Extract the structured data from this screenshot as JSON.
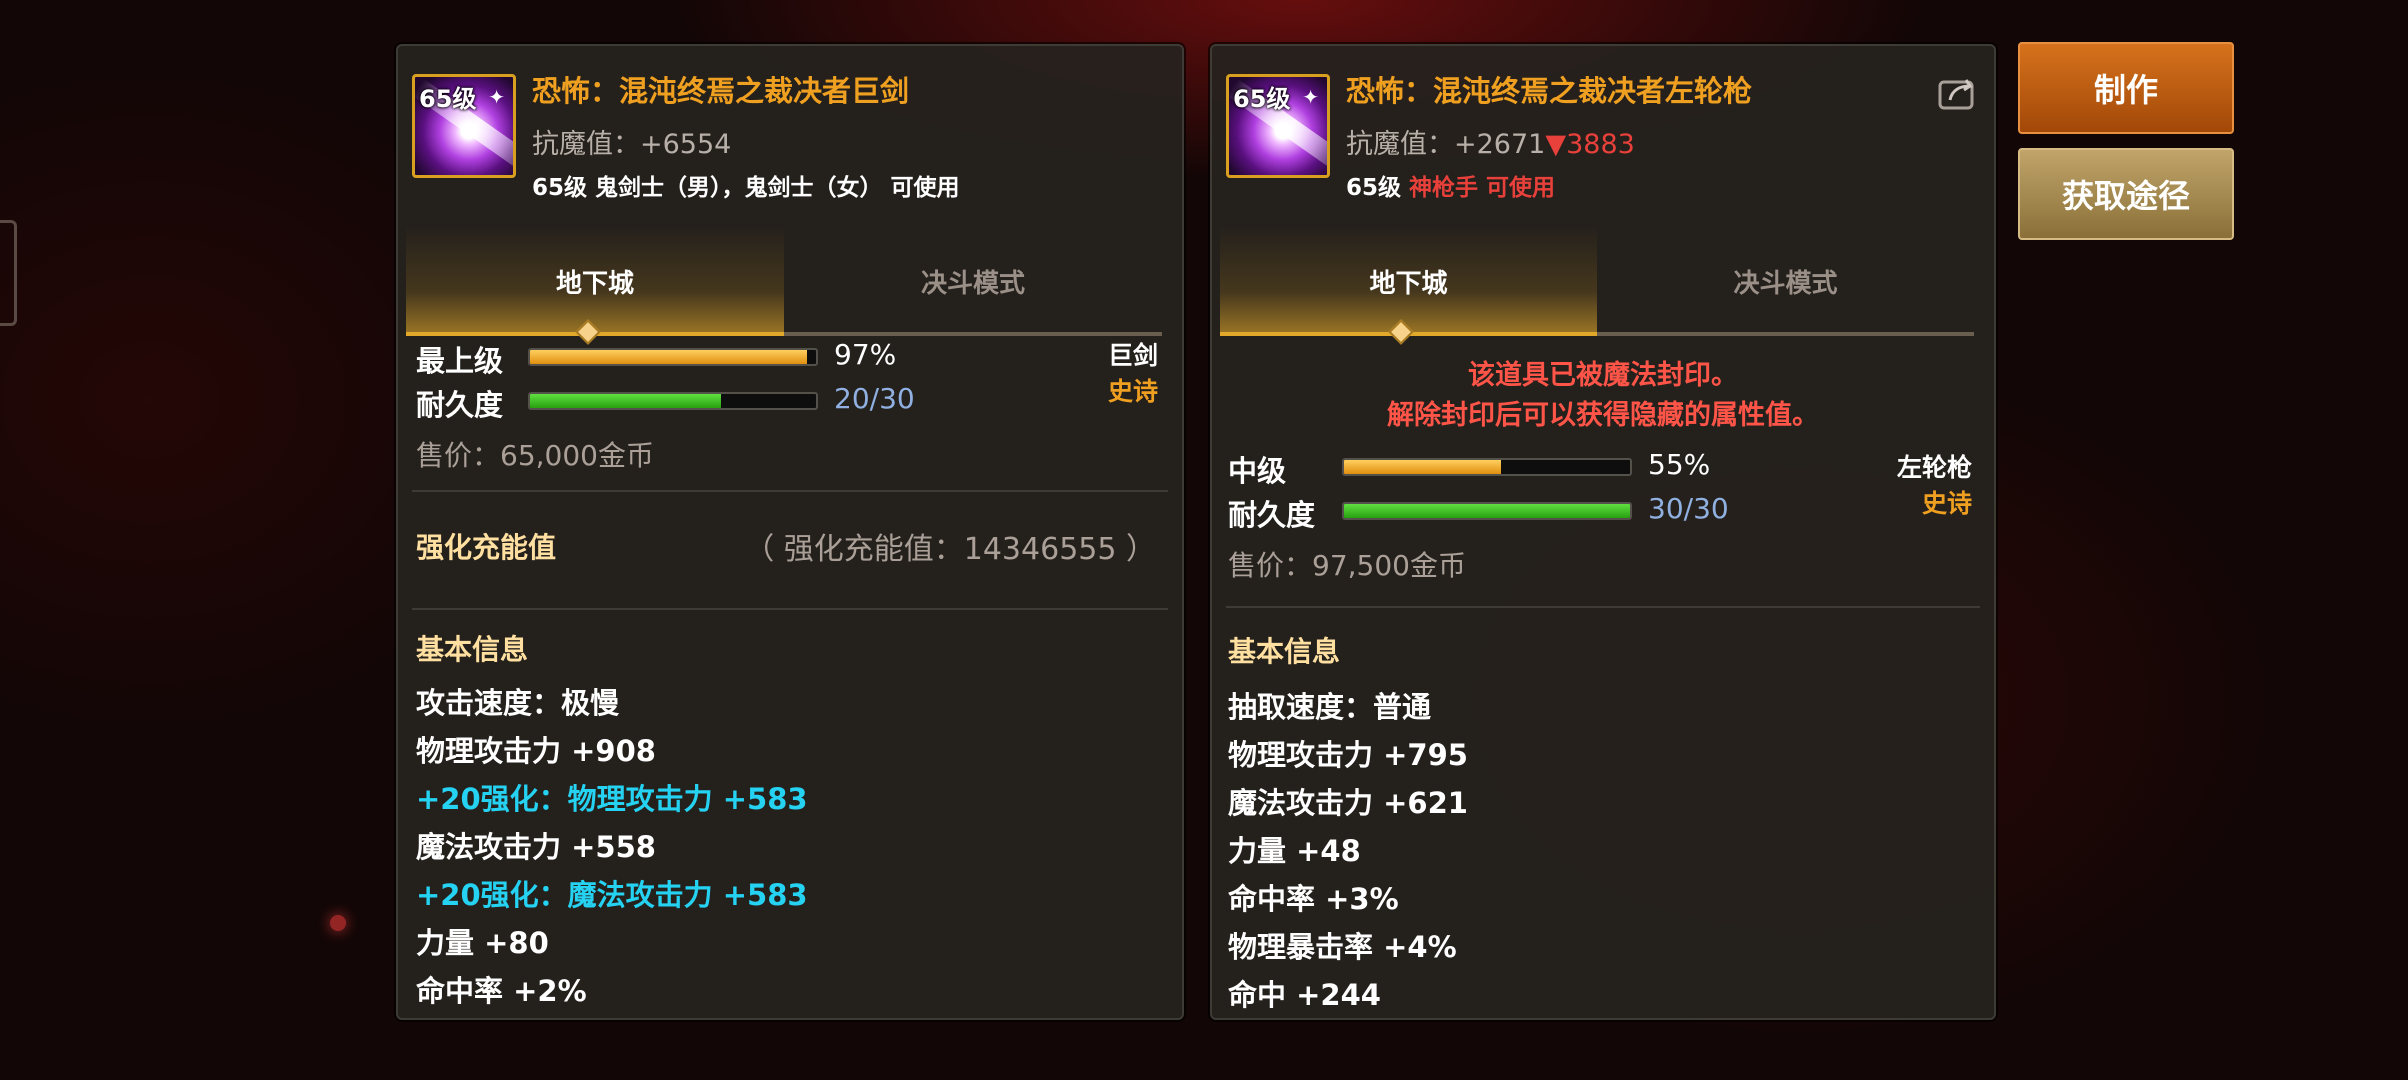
{
  "left_item": {
    "icon_level": "65级",
    "name": "恐怖：混沌终焉之裁决者巨剑",
    "anti_magic": "抗魔值：+6554",
    "usable": "65级 鬼剑士（男），鬼剑士（女） 可使用",
    "tabs": [
      "地下城",
      "决斗模式"
    ],
    "grade_label": "最上级",
    "grade_value": "97%",
    "grade_fraction": 0.97,
    "durability_label": "耐久度",
    "durability_value": "20/30",
    "durability_fraction": 0.667,
    "weapon_type": "巨剑",
    "rarity": "史诗",
    "price": "售价：65,000金币",
    "charge_title": "强化充能值",
    "charge_value": "（ 强化充能值：14346555 ）",
    "basic_info_title": "基本信息",
    "stats": [
      {
        "text": "攻击速度：极慢",
        "color": "white"
      },
      {
        "text": "物理攻击力 +908",
        "color": "white"
      },
      {
        "text": "+20强化：物理攻击力 +583",
        "color": "cyan"
      },
      {
        "text": "魔法攻击力 +558",
        "color": "white"
      },
      {
        "text": "+20强化：魔法攻击力 +583",
        "color": "cyan"
      },
      {
        "text": "力量 +80",
        "color": "white"
      },
      {
        "text": "命中率 +2%",
        "color": "white"
      }
    ]
  },
  "right_item": {
    "icon_level": "65级",
    "name": "恐怖：混沌终焉之裁决者左轮枪",
    "anti_magic": "抗魔值：+2671",
    "anti_magic_diff": "▼3883",
    "usable_level": "65级",
    "usable_class": "神枪手 可使用",
    "tabs": [
      "地下城",
      "决斗模式"
    ],
    "sealed_line1": "该道具已被魔法封印。",
    "sealed_line2": "解除封印后可以获得隐藏的属性值。",
    "grade_label": "中级",
    "grade_value": "55%",
    "grade_fraction": 0.55,
    "durability_label": "耐久度",
    "durability_value": "30/30",
    "durability_fraction": 1.0,
    "weapon_type": "左轮枪",
    "rarity": "史诗",
    "price": "售价：97,500金币",
    "basic_info_title": "基本信息",
    "stats": [
      {
        "text": "抽取速度：普通",
        "color": "white"
      },
      {
        "text": "物理攻击力 +795",
        "color": "white"
      },
      {
        "text": "魔法攻击力 +621",
        "color": "white"
      },
      {
        "text": "力量 +48",
        "color": "white"
      },
      {
        "text": "命中率 +3%",
        "color": "white"
      },
      {
        "text": "物理暴击率 +4%",
        "color": "white"
      },
      {
        "text": "命中 +244",
        "color": "white"
      }
    ]
  },
  "buttons": {
    "craft": "制作",
    "source": "获取途径"
  },
  "colors": {
    "accent_orange": "#f0a020",
    "enhance_cyan": "#25d2f2",
    "warning_red": "#e8403a"
  }
}
